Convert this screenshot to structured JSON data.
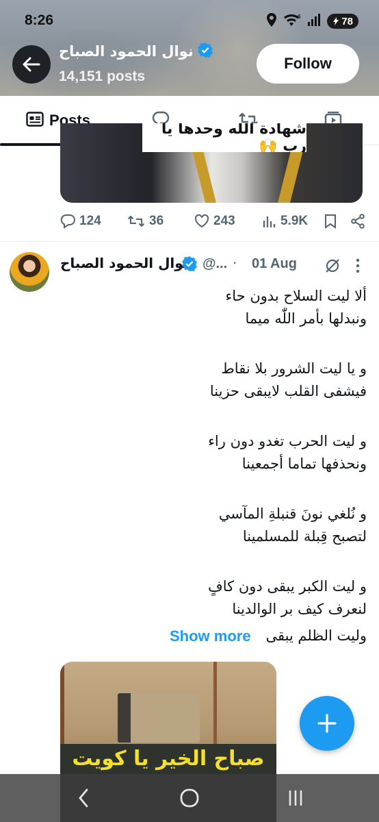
{
  "status_bar": {
    "time": "8:26",
    "network_superscript": "6",
    "battery": "78",
    "icons": [
      "location-icon",
      "wifi-icon",
      "signal-icon",
      "battery-icon"
    ]
  },
  "profile": {
    "name": "نوال الحمود الصباح",
    "posts_count": "14,151 posts",
    "follow_label": "Follow",
    "verified": true
  },
  "tabs": [
    {
      "label": "Posts",
      "icon": "posts-icon",
      "active": true
    },
    {
      "label": "",
      "icon": "reply-icon"
    },
    {
      "label": "",
      "icon": "repost-icon"
    },
    {
      "label": "",
      "icon": "media-icon"
    }
  ],
  "previous_tweet": {
    "media_caption": "شهادة الله وحدها يا رب 🙌",
    "replies": "124",
    "reposts": "36",
    "likes": "243",
    "views": "5.9K"
  },
  "tweet": {
    "author_name": "نوال الحمود الصباح",
    "handle": "@...",
    "separator": "·",
    "date": "01 Aug",
    "stanzas": [
      [
        "ألا ليت السلاح بدون حاء",
        "ونبدلها بأمر اللّٰه ميما"
      ],
      [
        "و يا ليت الشرور بلا نقاط",
        "فيشفى القلب لايبقى حزينا"
      ],
      [
        "و ليت الحرب تغدو دون راء",
        "ونحذفها تماما أجمعينا"
      ],
      [
        "و نُلغي نونَ قنبلةِ المآسي",
        "لتصبح قِبلة للمسلمينا"
      ],
      [
        "و ليت الكبر يبقى دون كافٍ",
        "لنعرف كيف بر الوالدينا"
      ]
    ],
    "last_line": "وليت الظلم يبقى",
    "show_more": "Show more",
    "media_caption": "صباح الخير يا كويت"
  },
  "fab": {
    "icon": "plus-icon"
  },
  "system_nav": [
    "back-nav-icon",
    "home-nav-icon",
    "recents-nav-icon"
  ],
  "colors": {
    "accent": "#1d9bf0",
    "text": "#0f1419",
    "muted": "#536471"
  }
}
